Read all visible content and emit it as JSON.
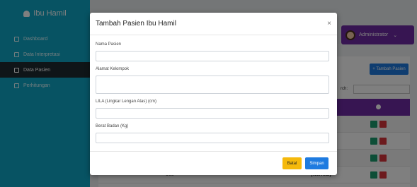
{
  "sidebar": {
    "brand": "Ibu Hamil",
    "items": [
      {
        "label": "Dashboard",
        "icon": "home-icon"
      },
      {
        "label": "Data Interpretasi",
        "icon": "file-icon"
      },
      {
        "label": "Data Pasien",
        "icon": "user-icon"
      },
      {
        "label": "Perhitungan",
        "icon": "file-icon"
      }
    ]
  },
  "header": {
    "user": "Administrator"
  },
  "panel": {
    "add_label": "+ Tambah Pasien",
    "search_label": "rch:",
    "rows": [
      {
        "c1": "",
        "c2": ""
      },
      {
        "c1": "",
        "c2": ""
      },
      {
        "c1": "",
        "c2": ""
      },
      {
        "c1": "008",
        "c2": "(Normal)"
      }
    ]
  },
  "modal": {
    "title": "Tambah Pasien Ibu Hamil",
    "close": "×",
    "fields": {
      "nama_label": "Nama Pasien",
      "alamat_label": "Alamat Kelompok",
      "lila_label": "LILA (Lingkar Lengan Atas) (cm)",
      "berat_label": "Berat Badan (Kg)"
    },
    "buttons": {
      "cancel": "Batal",
      "save": "Simpan"
    }
  },
  "colors": {
    "sidebar": "#0fa7c6",
    "primary": "#1e7be0",
    "accent": "#6f2aa5",
    "warning": "#f5b90c"
  }
}
